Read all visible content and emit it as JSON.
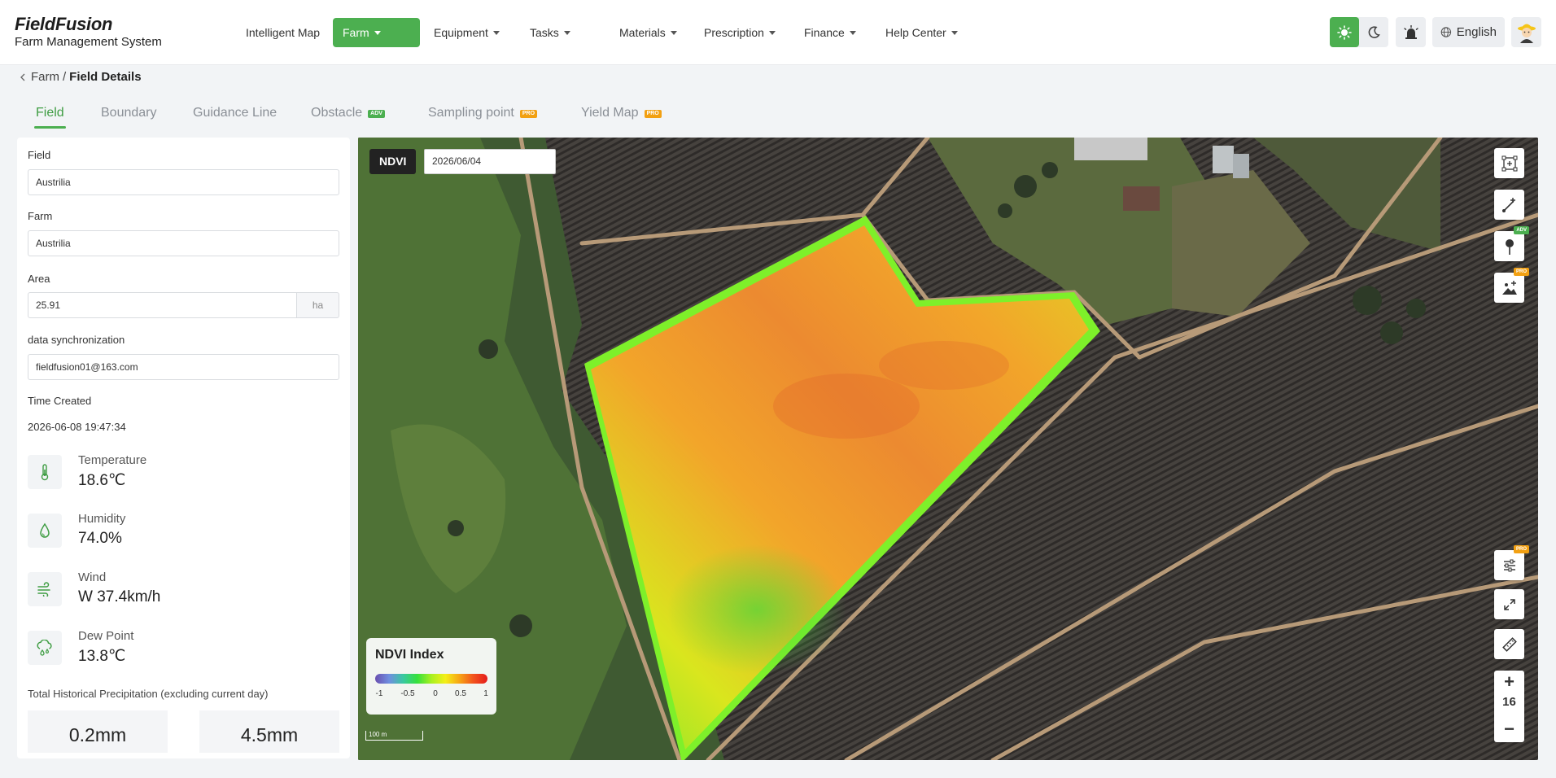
{
  "brand": {
    "name": "FieldFusion",
    "subtitle": "Farm Management System"
  },
  "nav": {
    "items": [
      {
        "label": "Intelligent Map",
        "dropdown": false,
        "active": false
      },
      {
        "label": "Farm",
        "dropdown": true,
        "active": true
      },
      {
        "label": "Equipment",
        "dropdown": true,
        "active": false
      },
      {
        "label": "Tasks",
        "dropdown": true,
        "active": false
      },
      {
        "label": "Materials",
        "dropdown": true,
        "active": false
      },
      {
        "label": "Prescription",
        "dropdown": true,
        "active": false
      },
      {
        "label": "Finance",
        "dropdown": true,
        "active": false
      },
      {
        "label": "Help Center",
        "dropdown": true,
        "active": false
      }
    ]
  },
  "header": {
    "theme": "light",
    "language": "English",
    "accent_color": "#4caf50"
  },
  "breadcrumb": {
    "parent": "Farm",
    "separator": "/",
    "current": "Field Details"
  },
  "tabs": [
    {
      "label": "Field",
      "active": true,
      "badge": ""
    },
    {
      "label": "Boundary",
      "active": false,
      "badge": ""
    },
    {
      "label": "Guidance Line",
      "active": false,
      "badge": ""
    },
    {
      "label": "Obstacle",
      "active": false,
      "badge": "ADV"
    },
    {
      "label": "Sampling point",
      "active": false,
      "badge": "PRO"
    },
    {
      "label": "Yield Map",
      "active": false,
      "badge": "PRO"
    }
  ],
  "details": {
    "field_label": "Field",
    "field_value": "Austrilia",
    "farm_label": "Farm",
    "farm_value": "Austrilia",
    "area_label": "Area",
    "area_value": "25.91",
    "area_unit": "ha",
    "sync_label": "data synchronization",
    "sync_value": "fieldfusion01@163.com",
    "created_label": "Time Created",
    "created_value": "2026-06-08 19:47:34"
  },
  "weather": [
    {
      "label": "Temperature",
      "value": "18.6℃",
      "icon": "thermometer-icon"
    },
    {
      "label": "Humidity",
      "value": "74.0%",
      "icon": "droplet-icon"
    },
    {
      "label": "Wind",
      "value": "W 37.4km/h",
      "icon": "wind-icon"
    },
    {
      "label": "Dew Point",
      "value": "13.8℃",
      "icon": "dew-point-icon"
    }
  ],
  "precipitation": {
    "title": "Total Historical Precipitation (excluding current day)",
    "values": [
      "0.2mm",
      "4.5mm"
    ]
  },
  "map": {
    "layer": "NDVI",
    "date": "2026/06/04",
    "zoom": "16",
    "scale": "100 m",
    "legend": {
      "title": "NDVI Index",
      "ticks": [
        "-1",
        "-0.5",
        "0",
        "0.5",
        "1"
      ],
      "colors": [
        "#6a4fb0",
        "#39c8a0",
        "#36e03c",
        "#f4ef18",
        "#e51c1c"
      ]
    },
    "tools": [
      {
        "name": "draw-area-tool",
        "badge": ""
      },
      {
        "name": "draw-line-tool",
        "badge": ""
      },
      {
        "name": "pin-tool",
        "badge": "ADV"
      },
      {
        "name": "image-layer-tool",
        "badge": "PRO"
      },
      {
        "name": "filter-settings-tool",
        "badge": "PRO"
      },
      {
        "name": "fullscreen-tool",
        "badge": ""
      },
      {
        "name": "measure-tool",
        "badge": ""
      }
    ]
  }
}
